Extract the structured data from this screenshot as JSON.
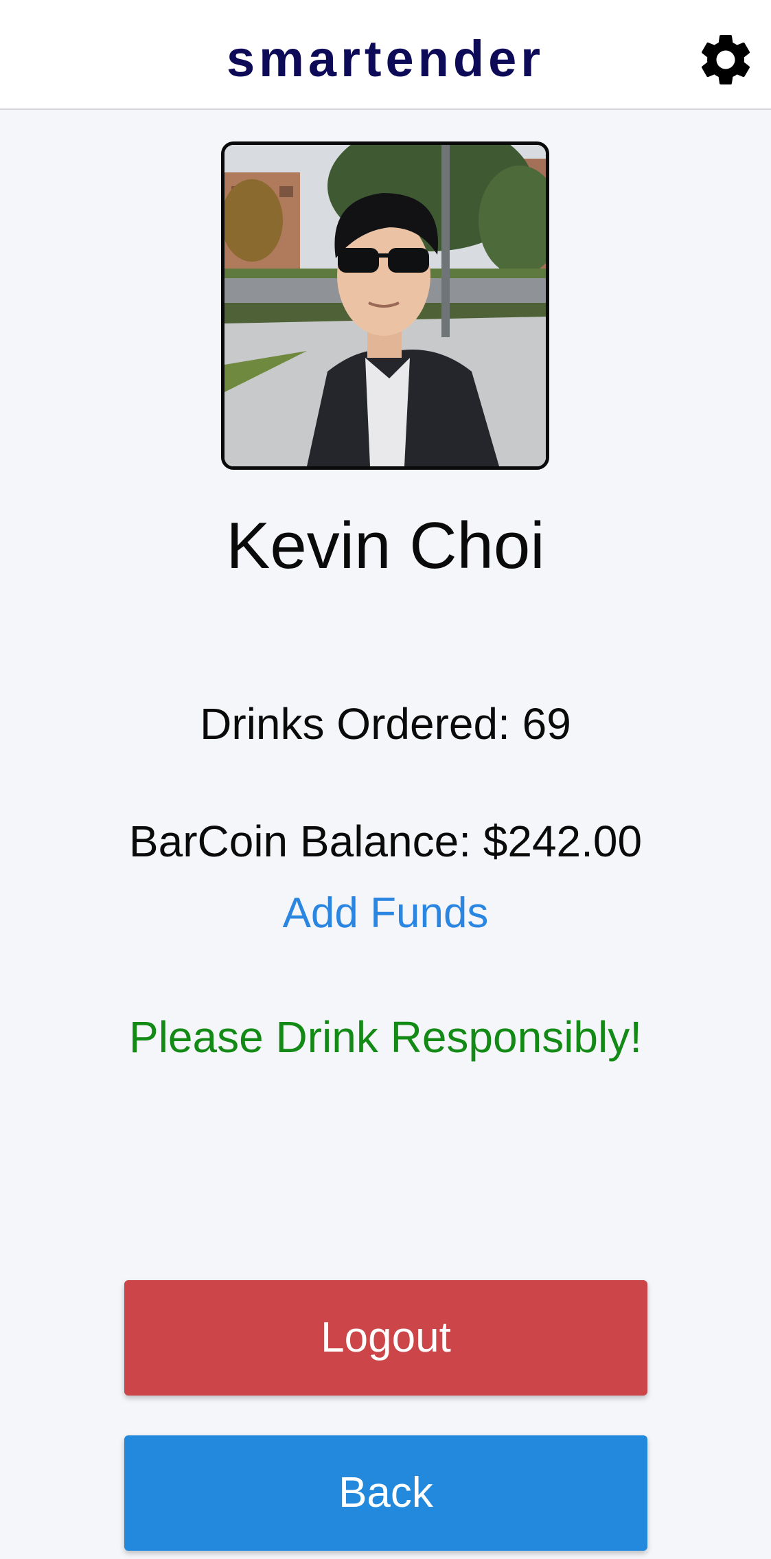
{
  "header": {
    "title": "smartender",
    "settings_icon": "gear-icon"
  },
  "profile": {
    "name": "Kevin Choi",
    "drinks_label": "Drinks Ordered: 69",
    "balance_label": "BarCoin Balance: $242.00",
    "add_funds_label": "Add Funds",
    "notice": "Please Drink Responsibly!"
  },
  "actions": {
    "logout_label": "Logout",
    "back_label": "Back"
  },
  "colors": {
    "title": "#0d0a57",
    "link": "#2a86e0",
    "notice": "#138a16",
    "logout": "#cc4549",
    "back": "#2389dc"
  }
}
